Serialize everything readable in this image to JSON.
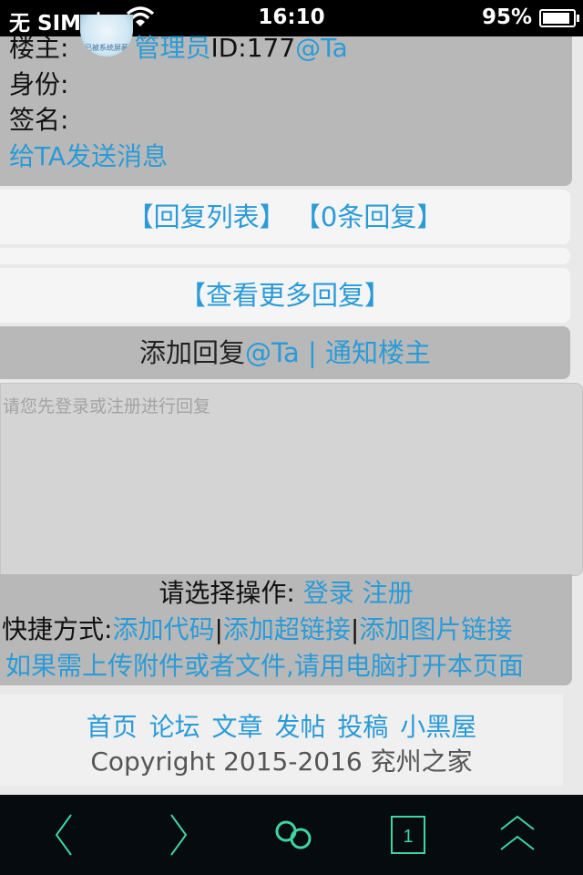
{
  "status_bar": {
    "carrier": "无 SIM 卡",
    "wifi_icon": "wifi-icon",
    "time": "16:10",
    "battery": "95%"
  },
  "author": {
    "host_label": "楼主:",
    "host_name": "管理员",
    "host_id": "ID:177",
    "at_label": "@Ta",
    "identity_label": "身份:",
    "signature_label": "签名:",
    "message_link": "给TA发送消息"
  },
  "reply_list": {
    "list_label": "【回复列表】",
    "count_label": "【0条回复】"
  },
  "more_replies": "【查看更多回复】",
  "add_reply": {
    "title": "添加回复",
    "at_label": "@Ta",
    "separator": "|",
    "notify_label": "通知楼主",
    "placeholder": "请您先登录或注册进行回复"
  },
  "operations": {
    "prompt": "请选择操作:",
    "login": "登录",
    "register": "注册",
    "shortcut_label": "快捷方式:",
    "add_code": "添加代码",
    "sep": "|",
    "add_link": "添加超链接",
    "add_image": "添加图片链接",
    "attachment_note": "如果需上传附件或者文件,请用电脑打开本页面"
  },
  "footer": {
    "nav": [
      "首页",
      "论坛",
      "文章",
      "发帖",
      "投稿",
      "小黑屋"
    ],
    "copyright": "Copyright 2015-2016 兖州之家"
  },
  "toolbar": {
    "page_number": "1",
    "icons": [
      "back-arrow-icon",
      "forward-arrow-icon",
      "browser-menu-icon",
      "tabs-icon",
      "home-up-icon"
    ]
  },
  "colors": {
    "link": "#2a9bd8",
    "panel_gray": "#b8b8b8",
    "toolbar_bg": "#060b10",
    "toolbar_glow": "#3fd59f"
  }
}
